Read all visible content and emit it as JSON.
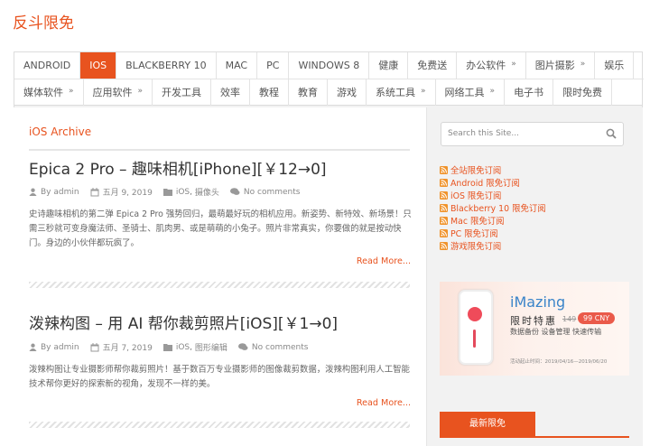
{
  "site": {
    "title": "反斗限免"
  },
  "nav": {
    "row1": [
      {
        "label": "ANDROID",
        "active": false,
        "has_sub": false
      },
      {
        "label": "IOS",
        "active": true,
        "has_sub": false
      },
      {
        "label": "BLACKBERRY 10",
        "active": false,
        "has_sub": false
      },
      {
        "label": "MAC",
        "active": false,
        "has_sub": false
      },
      {
        "label": "PC",
        "active": false,
        "has_sub": false
      },
      {
        "label": "WINDOWS 8",
        "active": false,
        "has_sub": false
      },
      {
        "label": "健康",
        "active": false,
        "has_sub": false
      },
      {
        "label": "免费送",
        "active": false,
        "has_sub": false
      },
      {
        "label": "办公软件",
        "active": false,
        "has_sub": true
      },
      {
        "label": "图片摄影",
        "active": false,
        "has_sub": true
      },
      {
        "label": "娱乐",
        "active": false,
        "has_sub": false
      }
    ],
    "row2": [
      {
        "label": "媒体软件",
        "active": false,
        "has_sub": true
      },
      {
        "label": "应用软件",
        "active": false,
        "has_sub": true
      },
      {
        "label": "开发工具",
        "active": false,
        "has_sub": false
      },
      {
        "label": "效率",
        "active": false,
        "has_sub": false
      },
      {
        "label": "教程",
        "active": false,
        "has_sub": false
      },
      {
        "label": "教育",
        "active": false,
        "has_sub": false
      },
      {
        "label": "游戏",
        "active": false,
        "has_sub": false
      },
      {
        "label": "系统工具",
        "active": false,
        "has_sub": true
      },
      {
        "label": "网络工具",
        "active": false,
        "has_sub": true
      },
      {
        "label": "电子书",
        "active": false,
        "has_sub": false
      },
      {
        "label": "限时免费",
        "active": false,
        "has_sub": false
      }
    ],
    "sub_marker": "»"
  },
  "archive": {
    "title": "iOS Archive"
  },
  "posts": [
    {
      "title": "Epica 2 Pro – 趣味相机[iPhone][￥12→0]",
      "by": "By",
      "author": "admin",
      "date": "五月 9, 2019",
      "categories": [
        "iOS",
        "摄像头"
      ],
      "category_sep": ",",
      "comments": "No comments",
      "excerpt": "史诗趣味相机的第二弹 Epica 2 Pro 强势回归，最萌最好玩的相机应用。新姿势、新特效、新场景！只需三秒就可变身魔法师、圣骑士、肌肉男、或是萌萌的小兔子。照片非常真实，你要做的就是按动快门。身边的小伙伴都玩疯了。",
      "read_more": "Read More..."
    },
    {
      "title": "泼辣构图 – 用 AI 帮你裁剪照片[iOS][￥1→0]",
      "by": "By",
      "author": "admin",
      "date": "五月 7, 2019",
      "categories": [
        "iOS",
        "图形编辑"
      ],
      "category_sep": ",",
      "comments": "No comments",
      "excerpt": "泼辣构图让专业摄影师帮你裁剪照片！基于数百万专业摄影师的图像裁剪数据，泼辣构图利用人工智能技术帮你更好的探索新的视角，发现不一样的美。",
      "read_more": "Read More..."
    }
  ],
  "sidebar": {
    "search_placeholder": "Search this Site...",
    "feeds": [
      "全站限免订阅",
      "Android 限免订阅",
      "iOS 限免订阅",
      "Blackberry 10 限免订阅",
      "Mac 限免订阅",
      "PC 限免订阅",
      "游戏限免订阅"
    ],
    "ad": {
      "brand": "iMazing",
      "sale": "限时特惠",
      "old_price": "149",
      "new_price": "99 CNY",
      "tags": "数据备份  设备管理  快速传输",
      "date": "活动起止时间：2019/04/16—2019/06/20"
    },
    "widget_title": "最新限免"
  },
  "colors": {
    "accent": "#e8531f",
    "rss": "#f0932b"
  }
}
